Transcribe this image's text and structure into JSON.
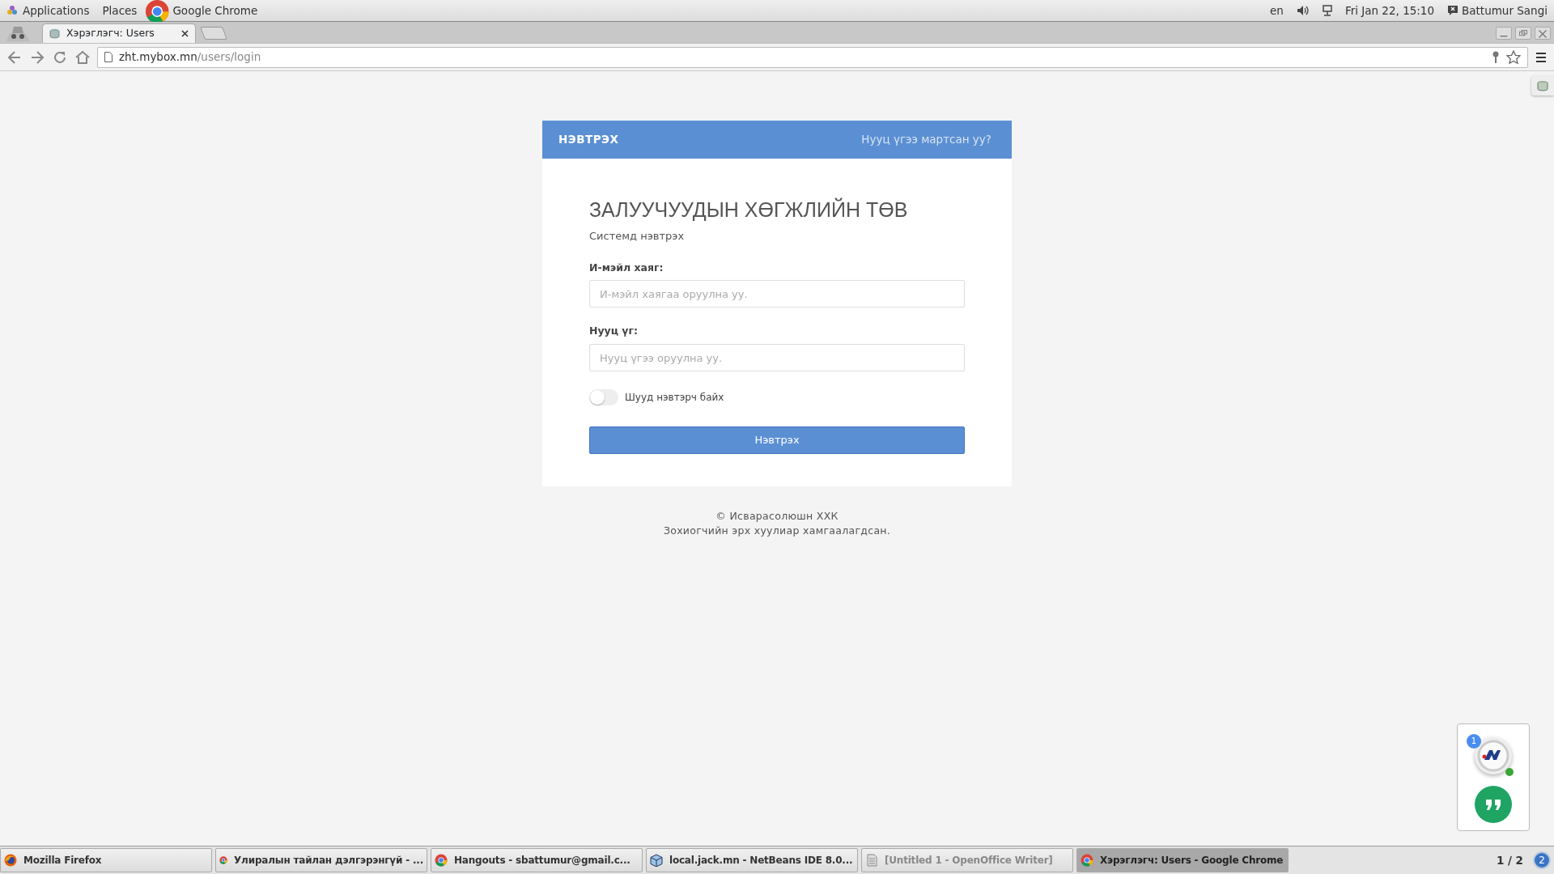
{
  "top_panel": {
    "menus": [
      "Applications",
      "Places"
    ],
    "app": "Google Chrome",
    "language": "en",
    "clock": "Fri Jan 22, 15:10",
    "user": "Battumur Sangi"
  },
  "browser": {
    "tabs": [
      {
        "title": "Хэрэглэгч: Users",
        "selected": true
      }
    ],
    "url": {
      "host": "zht.mybox.mn",
      "path": "/users/login"
    }
  },
  "login": {
    "header_title": "НЭВТРЭХ",
    "forgot_link": "Нууц үгээ мартсан уу?",
    "title": "ЗАЛУУЧУУДЫН ХӨГЖЛИЙН ТӨВ",
    "subtitle": "Системд нэвтрэх",
    "fields": [
      {
        "label": "И-мэйл хаяг:",
        "placeholder": "И-мэйл хаягаа оруулна уу."
      },
      {
        "label": "Нууц үг:",
        "placeholder": "Нууц үгээ оруулна уу."
      }
    ],
    "remember": {
      "label": "Шууд нэвтэрч байх",
      "checked": false
    },
    "submit": "Нэвтрэх"
  },
  "footer": [
    "© Исварасолюшн ХХК",
    "Зохиогчийн эрх хуулиар хамгаалагдсан."
  ],
  "chat_widget": {
    "badge": "1",
    "online": true
  },
  "taskbar": {
    "items": [
      {
        "kind": "firefox",
        "label": "Mozilla Firefox",
        "selected": false,
        "minimized": false
      },
      {
        "kind": "chrome",
        "label": "Улиралын тайлан дэлгэрэнгүй - ...",
        "selected": false,
        "minimized": false
      },
      {
        "kind": "chrome",
        "label": "Hangouts - sbattumur@gmail.c...",
        "selected": false,
        "minimized": false
      },
      {
        "kind": "netbeans",
        "label": "local.jack.mn - NetBeans IDE 8.0...",
        "selected": false,
        "minimized": false
      },
      {
        "kind": "writer",
        "label": "[Untitled 1 - OpenOffice Writer]",
        "selected": false,
        "minimized": true
      },
      {
        "kind": "chrome",
        "label": "Хэрэглэгч: Users - Google Chrome",
        "selected": true,
        "minimized": false
      }
    ],
    "workspace": "1 / 2",
    "notifications": "2"
  }
}
